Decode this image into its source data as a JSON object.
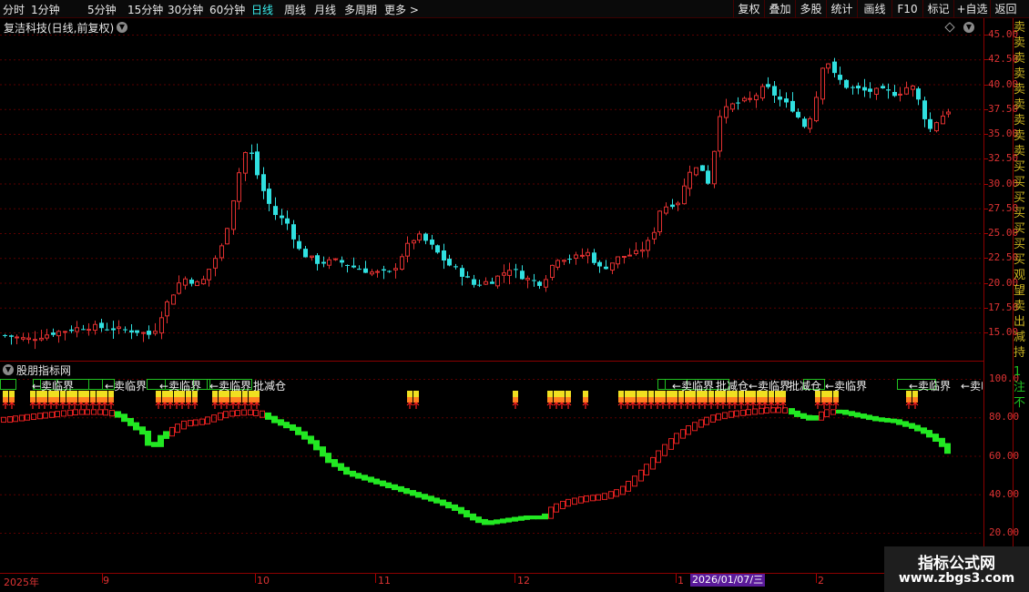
{
  "toolbar": {
    "periods": [
      "分时",
      "1分钟",
      "5分钟",
      "15分钟",
      "30分钟",
      "60分钟",
      "日线",
      "周线",
      "月线",
      "多周期",
      "更多 >"
    ],
    "active_period": "日线",
    "buttons": [
      "复权",
      "叠加",
      "多股",
      "统计",
      "画线",
      "F10",
      "标记",
      "+自选",
      "返回"
    ]
  },
  "main_chart": {
    "title": "复洁科技(日线,前复权)",
    "y_ticks": [
      "45.00",
      "42.50",
      "40.00",
      "37.50",
      "35.00",
      "32.50",
      "30.00",
      "27.50",
      "25.00",
      "22.50",
      "20.00",
      "17.50",
      "15.00"
    ],
    "up_color": "#e03030",
    "down_color": "#30e0e0"
  },
  "sub_chart": {
    "title": "股朋指标网",
    "y_ticks": [
      "100.0",
      "80.00",
      "60.00",
      "40.00",
      "20.00"
    ],
    "sell_label": "←卖临界",
    "reduce_label": "批减仓"
  },
  "x_axis": {
    "labels": [
      "2025年",
      "9",
      "10",
      "11",
      "12",
      "1",
      "2"
    ],
    "selected_date": "2026/01/07/三"
  },
  "side_panel": {
    "top_chars": "卖卖卖卖卖卖卖卖卖买买买买买买买观望卖出减持",
    "bottom_chars": "1注不"
  },
  "watermark": {
    "title": "指标公式网",
    "url": "www.zbgs3.com"
  }
}
